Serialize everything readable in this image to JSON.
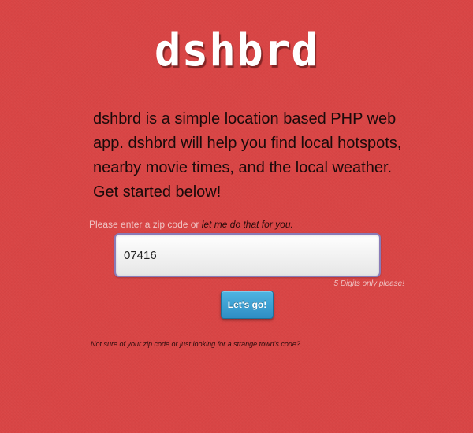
{
  "header": {
    "logo_text": "dshbrd"
  },
  "intro": {
    "text": "dshbrd is a simple location based PHP web app. dshbrd will help you find local hotspots, nearby movie times, and the local weather. Get started below!"
  },
  "zip_form": {
    "prompt_text": "Please enter a zip code or",
    "locate_link_text": "let me do that for you.",
    "input_value": "07416",
    "hint_text": "5 Digits only please!",
    "submit_label": "Let's go!"
  },
  "footer": {
    "note_text": "Not sure of your zip code or just looking for a strange town's code?"
  },
  "colors": {
    "background": "#d94545",
    "button": "#3a9fd3",
    "input_border": "#8a7bb8"
  }
}
